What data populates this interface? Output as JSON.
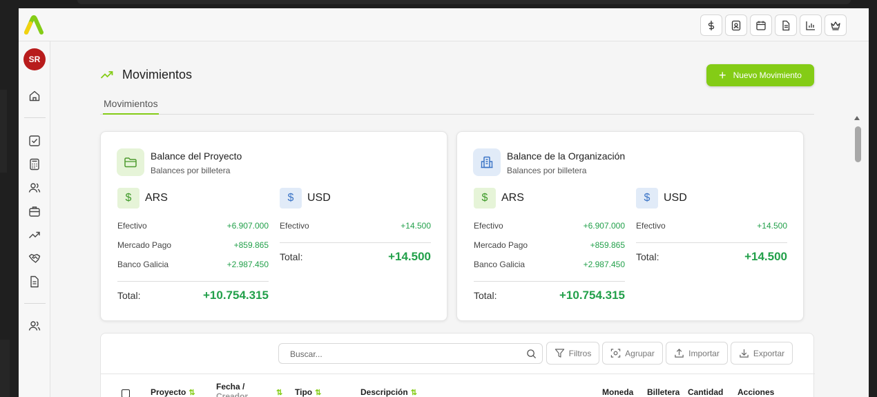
{
  "app": {
    "avatar_initials": "SR",
    "brand_color": "#84cc16"
  },
  "topbar": {
    "icons": [
      "dollar-icon",
      "contact-icon",
      "calendar-icon",
      "document-icon",
      "chart-icon",
      "crown-icon"
    ]
  },
  "sidebar": {
    "icons": [
      "home-icon",
      "checklist-icon",
      "calculator-icon",
      "users-icon",
      "briefcase-icon",
      "trending-icon",
      "handshake-icon",
      "report-icon",
      "team-icon"
    ]
  },
  "page": {
    "title": "Movimientos",
    "new_button": "Nuevo Movimiento",
    "tab": "Movimientos"
  },
  "project_card": {
    "title": "Balance del Proyecto",
    "subtitle": "Balances por billetera",
    "ars": {
      "currency": "ARS",
      "rows": [
        {
          "label": "Efectivo",
          "value": "+6.907.000"
        },
        {
          "label": "Mercado Pago",
          "value": "+859.865"
        },
        {
          "label": "Banco Galicia",
          "value": "+2.987.450"
        }
      ],
      "total_label": "Total:",
      "total_value": "+10.754.315"
    },
    "usd": {
      "currency": "USD",
      "rows": [
        {
          "label": "Efectivo",
          "value": "+14.500"
        }
      ],
      "total_label": "Total:",
      "total_value": "+14.500"
    }
  },
  "org_card": {
    "title": "Balance de la Organización",
    "subtitle": "Balances por billetera",
    "ars": {
      "currency": "ARS",
      "rows": [
        {
          "label": "Efectivo",
          "value": "+6.907.000"
        },
        {
          "label": "Mercado Pago",
          "value": "+859.865"
        },
        {
          "label": "Banco Galicia",
          "value": "+2.987.450"
        }
      ],
      "total_label": "Total:",
      "total_value": "+10.754.315"
    },
    "usd": {
      "currency": "USD",
      "rows": [
        {
          "label": "Efectivo",
          "value": "+14.500"
        }
      ],
      "total_label": "Total:",
      "total_value": "+14.500"
    }
  },
  "table": {
    "search_placeholder": "Buscar...",
    "buttons": {
      "filters": "Filtros",
      "group": "Agrupar",
      "import": "Importar",
      "export": "Exportar"
    },
    "columns": {
      "project": "Proyecto",
      "date": "Fecha /",
      "date_line2": "Creador",
      "type": "Tipo",
      "description": "Descripción",
      "currency": "Moneda",
      "wallet": "Billetera",
      "amount": "Cantidad",
      "actions": "Acciones"
    },
    "sort_glyph": "⇅"
  }
}
